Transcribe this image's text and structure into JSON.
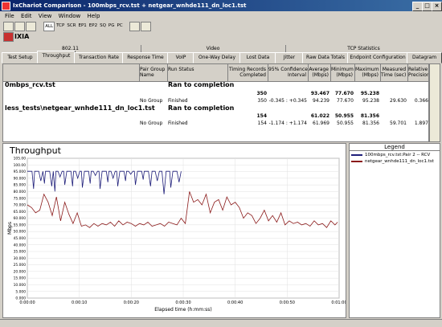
{
  "window": {
    "title": "IxChariot Comparison - 100mbps_rcv.tst + netgear_wnhde111_dn_loc1.tst",
    "controls": [
      "_",
      "□",
      "×"
    ]
  },
  "menu": [
    "File",
    "Edit",
    "View",
    "Window",
    "Help"
  ],
  "toolbar": {
    "buttons": [
      "ALL",
      "TCP",
      "SCR",
      "EP1",
      "EP2",
      "SQ",
      "PG",
      "PC"
    ],
    "brand": "IXIA"
  },
  "column_groups": [
    {
      "label": "802.11"
    },
    {
      "label": "Video"
    },
    {
      "label": "TCP Statistics"
    }
  ],
  "tabs": [
    {
      "label": "Test Setup"
    },
    {
      "label": "Throughput"
    },
    {
      "label": "Transaction Rate"
    },
    {
      "label": "Response Time"
    },
    {
      "label": "VoIP"
    },
    {
      "label": "One-Way Delay"
    },
    {
      "label": "Lost Data"
    },
    {
      "label": "Jitter"
    },
    {
      "label": "Raw Data Totals"
    },
    {
      "label": "Endpoint Configuration"
    },
    {
      "label": "Datagram"
    }
  ],
  "grid": {
    "headers": {
      "pair_group": "Pair Group\nName",
      "run_status": "Run Status",
      "timing": "Timing Records\nCompleted",
      "conf": "95% Confidence\nInterval",
      "avg": "Average\n(Mbps)",
      "min": "Minimum\n(Mbps)",
      "max": "Maximum\n(Mbps)",
      "measured": "Measured\nTime (sec)",
      "relative": "Relative\nPrecision"
    },
    "rows": [
      {
        "file": "0mbps_rcv.tst",
        "status": "Ran to completion",
        "timing": "350",
        "avg": "93.467",
        "min": "77.670",
        "max": "95.238",
        "sub": {
          "group": "No Group",
          "status": "Finished",
          "timing": "350",
          "conf": "-0.345 : +0.345",
          "avg": "94.239",
          "min": "77.670",
          "max": "95.238",
          "measured": "29.630",
          "relative": "0.366"
        }
      },
      {
        "file": "less_tests\\netgear_wnhde111_dn_loc1.tst",
        "status": "Ran to completion",
        "timing": "154",
        "avg": "61.022",
        "min": "50.955",
        "max": "81.356",
        "sub": {
          "group": "No Group",
          "status": "Finished",
          "timing": "154",
          "conf": "-1.174 : +1.174",
          "avg": "61.969",
          "min": "50.955",
          "max": "81.356",
          "measured": "59.701",
          "relative": "1.897"
        }
      }
    ]
  },
  "legend": {
    "title": "Legend",
    "items": [
      {
        "label": "100mbps_rcv.tst:Pair 2 -- RCV",
        "color": "#1f1f7a"
      },
      {
        "label": "netgear_wnhde111_dn_loc1.tst",
        "color": "#8b1a1a"
      }
    ]
  },
  "chart_data": {
    "type": "line",
    "title": "Throughput",
    "xlabel": "Elapsed time (h:mm:ss)",
    "ylabel": "Mbps",
    "xlim": [
      0,
      60
    ],
    "ylim": [
      0,
      105
    ],
    "grid": true,
    "x_ticks": [
      "0:00:00",
      "0:00:10",
      "0:00:20",
      "0:00:30",
      "0:00:40",
      "0:00:50",
      "0:01:00"
    ],
    "x_tick_values": [
      0,
      10,
      20,
      30,
      40,
      50,
      60
    ],
    "y_ticks": [
      "0.000",
      "5.000",
      "10.000",
      "15.000",
      "20.000",
      "25.000",
      "30.000",
      "35.000",
      "40.000",
      "45.000",
      "50.000",
      "55.000",
      "60.000",
      "65.000",
      "70.000",
      "75.000",
      "80.000",
      "85.000",
      "90.000",
      "95.000",
      "100.00",
      "105.00"
    ],
    "y_tick_values": [
      0,
      5,
      10,
      15,
      20,
      25,
      30,
      35,
      40,
      45,
      50,
      55,
      60,
      65,
      70,
      75,
      80,
      85,
      90,
      95,
      100,
      105
    ],
    "series": [
      {
        "name": "100mbps_rcv.tst:Pair 2 -- RCV",
        "color": "#1f1f7a",
        "x": [
          0.0,
          0.4,
          0.9,
          1.2,
          1.4,
          1.8,
          2.2,
          2.6,
          3.0,
          3.3,
          3.5,
          3.9,
          4.3,
          4.7,
          5.0,
          5.3,
          5.5,
          5.9,
          6.3,
          6.7,
          7.0,
          7.2,
          7.6,
          8.0,
          8.4,
          8.7,
          8.9,
          9.3,
          9.7,
          10.1,
          10.4,
          10.6,
          11.0,
          11.4,
          11.8,
          12.1,
          12.3,
          12.7,
          13.1,
          13.5,
          13.8,
          14.0,
          14.4,
          14.8,
          15.2,
          15.5,
          15.7,
          16.1,
          16.5,
          16.9,
          17.2,
          17.4,
          17.8,
          18.2,
          18.6,
          18.9,
          19.1,
          19.5,
          19.9,
          20.3,
          20.6,
          20.8,
          21.2,
          21.6,
          22.0,
          22.3,
          22.5,
          22.9,
          23.3,
          23.7,
          24.0,
          24.2,
          24.6,
          25.0,
          25.4,
          25.7,
          25.9,
          26.3,
          26.7,
          27.1,
          27.4,
          27.6,
          28.0,
          28.4,
          28.8,
          29.2,
          29.6
        ],
        "y": [
          95.2,
          95.2,
          95.2,
          82,
          95.2,
          95.2,
          95.2,
          88,
          95.2,
          86,
          95.2,
          95.2,
          95.2,
          84,
          95.2,
          80,
          95.2,
          95.2,
          91,
          95.2,
          95.2,
          85,
          95.2,
          95.2,
          95.2,
          84,
          95.2,
          95.2,
          90,
          95.2,
          95.2,
          83,
          95.2,
          95.2,
          95.2,
          86,
          95.2,
          95.2,
          92,
          95.2,
          95.2,
          82,
          95.2,
          95.2,
          95.2,
          87,
          95.2,
          95.2,
          90,
          95.2,
          95.2,
          84,
          95.2,
          95.2,
          95.2,
          88,
          95.2,
          95.2,
          93,
          95.2,
          95.2,
          85,
          95.2,
          95.2,
          95.2,
          89,
          95.2,
          95.2,
          95.2,
          84,
          95.2,
          95.2,
          95.2,
          88,
          95.2,
          95.2,
          95.2,
          78,
          95.2,
          95.2,
          95.2,
          83,
          95.2,
          95.2,
          95.2,
          87,
          95.2
        ]
      },
      {
        "name": "netgear_wnhde111_dn_loc1.tst",
        "color": "#8b1a1a",
        "x": [
          0,
          0.8,
          1.6,
          2.4,
          3.2,
          4.0,
          4.8,
          5.6,
          6.4,
          7.2,
          8.0,
          8.8,
          9.6,
          10.4,
          11.2,
          12.0,
          12.8,
          13.6,
          14.4,
          15.2,
          16.0,
          16.8,
          17.6,
          18.4,
          19.2,
          20.0,
          20.8,
          21.6,
          22.4,
          23.2,
          24.0,
          24.8,
          25.6,
          26.4,
          27.2,
          28.0,
          28.8,
          29.6,
          30.4,
          31.2,
          32.0,
          32.8,
          33.6,
          34.4,
          35.2,
          36.0,
          36.8,
          37.6,
          38.4,
          39.2,
          40.0,
          40.8,
          41.6,
          42.4,
          43.2,
          44.0,
          44.8,
          45.6,
          46.4,
          47.2,
          48.0,
          48.8,
          49.6,
          50.4,
          51.2,
          52.0,
          52.8,
          53.6,
          54.4,
          55.2,
          56.0,
          56.8,
          57.6,
          58.4,
          59.2,
          59.7
        ],
        "y": [
          70,
          68,
          64,
          66,
          78,
          72,
          62,
          76,
          58,
          72,
          63,
          56,
          64,
          54,
          55,
          53,
          56,
          54,
          56,
          55,
          57,
          54,
          58,
          55,
          57,
          56,
          54,
          56,
          55,
          57,
          54,
          55,
          56,
          54,
          57,
          56,
          55,
          60,
          56,
          80,
          72,
          74,
          70,
          78,
          64,
          72,
          74,
          66,
          76,
          70,
          72,
          68,
          60,
          64,
          62,
          56,
          60,
          66,
          58,
          62,
          57,
          64,
          55,
          58,
          56,
          57,
          55,
          56,
          54,
          58,
          55,
          56,
          53,
          58,
          55,
          57
        ]
      }
    ]
  }
}
